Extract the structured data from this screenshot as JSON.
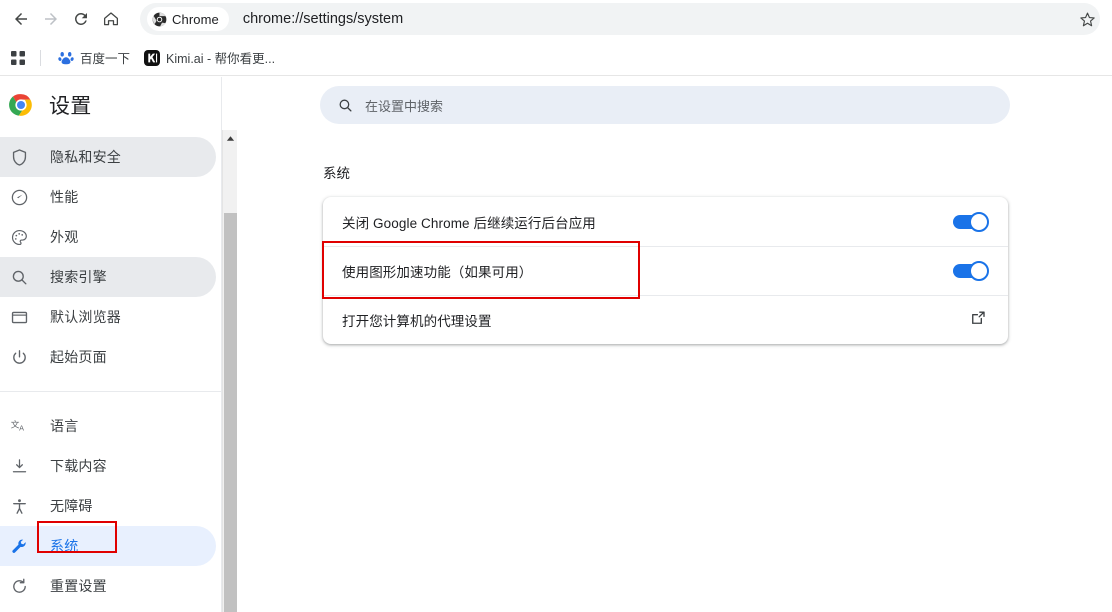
{
  "browser": {
    "nav": {
      "back": "back-arrow",
      "forward": "forward-arrow",
      "reload": "reload",
      "home": "home"
    },
    "omnibox": {
      "chip_label": "Chrome",
      "chip_icon": "chrome-logo-mono-icon",
      "url": "chrome://settings/system",
      "star_icon": "bookmark-star-icon"
    },
    "bookmarks_bar": {
      "apps_icon": "apps-grid-icon",
      "items": [
        {
          "label": "百度一下",
          "favicon": "baidu-paw-icon"
        },
        {
          "label": "Kimi.ai - 帮你看更...",
          "favicon": "kimi-k-icon"
        }
      ]
    }
  },
  "settings": {
    "brand": {
      "logo": "chrome-logo-color-icon",
      "title": "设置"
    },
    "nav_groups": [
      {
        "items": [
          {
            "label": "隐私和安全",
            "icon": "shield-icon",
            "state": "normal"
          },
          {
            "label": "性能",
            "icon": "speedometer-icon",
            "state": "normal"
          },
          {
            "label": "外观",
            "icon": "palette-icon",
            "state": "normal"
          },
          {
            "label": "搜索引擎",
            "icon": "search-icon",
            "state": "hovered"
          },
          {
            "label": "默认浏览器",
            "icon": "browser-window-icon",
            "state": "normal"
          },
          {
            "label": "起始页面",
            "icon": "power-icon",
            "state": "normal"
          }
        ]
      },
      {
        "items": [
          {
            "label": "语言",
            "icon": "translate-icon",
            "state": "normal"
          },
          {
            "label": "下载内容",
            "icon": "download-icon",
            "state": "normal"
          },
          {
            "label": "无障碍",
            "icon": "accessibility-icon",
            "state": "normal"
          },
          {
            "label": "系统",
            "icon": "wrench-icon",
            "state": "selected"
          },
          {
            "label": "重置设置",
            "icon": "reset-icon",
            "state": "normal"
          }
        ]
      }
    ],
    "search": {
      "icon": "search-icon",
      "placeholder": "在设置中搜索",
      "value": ""
    },
    "section_title": "系统",
    "rows": [
      {
        "label": "关闭 Google Chrome 后继续运行后台应用",
        "control": "toggle",
        "toggle_on": true
      },
      {
        "label": "使用图形加速功能（如果可用）",
        "control": "toggle",
        "toggle_on": true
      },
      {
        "label": "打开您计算机的代理设置",
        "control": "external-link",
        "icon": "external-link-icon"
      }
    ],
    "scrollbar": {
      "up_arrow_icon": "scroll-up-arrow-icon"
    }
  },
  "annotations": [
    {
      "name": "graphics-acceleration-row-highlight",
      "color": "#e00000"
    },
    {
      "name": "sidebar-system-item-highlight",
      "color": "#e00000"
    }
  ],
  "colors": {
    "accent_blue": "#1a73e8",
    "selected_nav_bg": "#e8f0fe",
    "hover_nav_bg": "#e8eaed",
    "search_bg": "#e9eef6",
    "annotation_red": "#e00000"
  }
}
